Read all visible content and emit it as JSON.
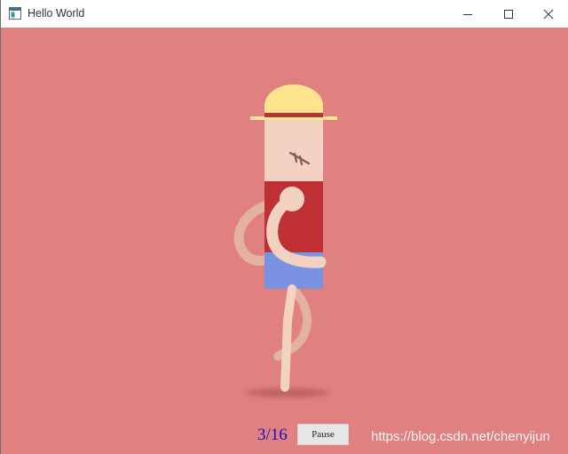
{
  "window": {
    "title": "Hello World",
    "icon": "app-window-icon",
    "controls": [
      "minimize-icon",
      "maximize-icon",
      "close-icon"
    ]
  },
  "canvas": {
    "background_color": "#e08080",
    "character": {
      "hat_color": "#fde58f",
      "hat_band_color": "#b2363a",
      "skin_color": "#f3d2c1",
      "shirt_color": "#bf3035",
      "shorts_color": "#7993e2",
      "scar_color": "#8a5a55"
    }
  },
  "controls": {
    "frame_counter": "3/16",
    "frame_counter_color": "#1b11c8",
    "pause_label": "Pause"
  },
  "watermark": "https://blog.csdn.net/chenyijun"
}
